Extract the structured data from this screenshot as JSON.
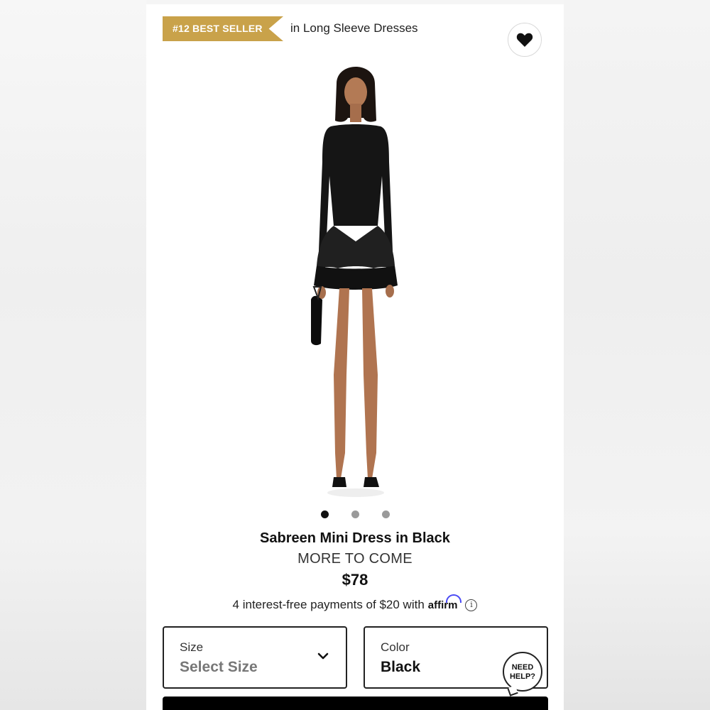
{
  "badge": {
    "label": "#12 BEST SELLER",
    "color": "#c9a24a"
  },
  "category": "in Long Sleeve Dresses",
  "favorite": {
    "icon": "heart-icon"
  },
  "gallery": {
    "dots": 3,
    "active_index": 0
  },
  "product": {
    "name": "Sabreen Mini Dress in Black",
    "status": "MORE TO COME",
    "price": "$78"
  },
  "financing": {
    "text": "4 interest-free payments of $20 with",
    "provider": "affirm",
    "info_icon": "info-icon"
  },
  "size_selector": {
    "label": "Size",
    "value": "Select Size",
    "icon": "chevron-down-icon"
  },
  "color_selector": {
    "label": "Color",
    "value": "Black"
  },
  "help": {
    "line1": "NEED",
    "line2": "HELP?"
  }
}
